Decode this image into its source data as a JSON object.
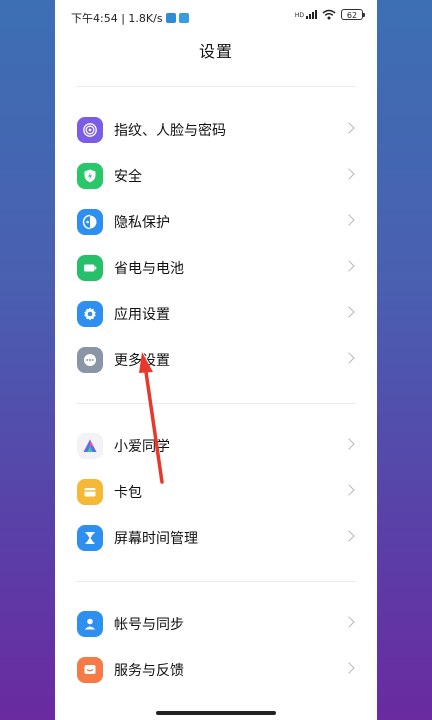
{
  "status_bar": {
    "time_speed": "下午4:54 | 1.8K/s",
    "signal_tag": "HD",
    "battery": "62"
  },
  "header": {
    "title": "设置"
  },
  "groups": [
    {
      "items": [
        {
          "label": "指纹、人脸与密码",
          "icon": "fingerprint-icon",
          "color": "#7b5ce6"
        },
        {
          "label": "安全",
          "icon": "shield-icon",
          "color": "#28c76a"
        },
        {
          "label": "隐私保护",
          "icon": "privacy-icon",
          "color": "#2d8ff0"
        },
        {
          "label": "省电与电池",
          "icon": "battery-icon",
          "color": "#26c06b"
        },
        {
          "label": "应用设置",
          "icon": "gear-icon",
          "color": "#2d8ff0"
        },
        {
          "label": "更多设置",
          "icon": "more-icon",
          "color": "#8a96a8"
        }
      ]
    },
    {
      "items": [
        {
          "label": "小爱同学",
          "icon": "xiaoai-icon",
          "color": "#f3f3f6"
        },
        {
          "label": "卡包",
          "icon": "wallet-icon",
          "color": "#f5b935"
        },
        {
          "label": "屏幕时间管理",
          "icon": "hourglass-icon",
          "color": "#2d8ff0"
        }
      ]
    },
    {
      "items": [
        {
          "label": "帐号与同步",
          "icon": "account-icon",
          "color": "#2d8ff0"
        },
        {
          "label": "服务与反馈",
          "icon": "feedback-icon",
          "color": "#f57a45"
        }
      ]
    }
  ],
  "annotation": {
    "color": "#e8382c"
  }
}
